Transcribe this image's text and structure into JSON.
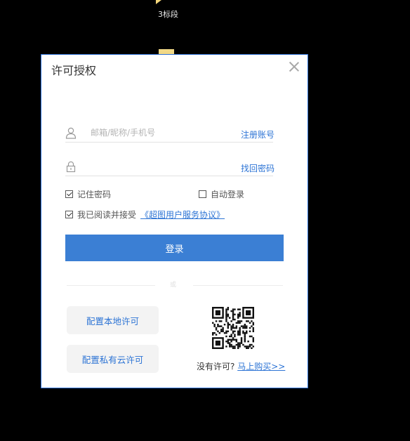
{
  "background": {
    "label": "3标段"
  },
  "dialog": {
    "title": "许可授权",
    "username_placeholder": "邮箱/昵称/手机号",
    "register_link": "注册账号",
    "password_placeholder": "",
    "forgot_link": "找回密码",
    "remember_label": "记住密码",
    "remember_checked": true,
    "autologin_label": "自动登录",
    "autologin_checked": false,
    "agree_label": "我已阅读并接受",
    "agree_checked": true,
    "agreement_link": "《超图用户服务协议》",
    "login_button": "登录",
    "divider_text": "或",
    "config_local_button": "配置本地许可",
    "config_cloud_button": "配置私有云许可",
    "no_license_text": "没有许可?",
    "buy_link": "马上购买>>"
  },
  "colors": {
    "accent": "#3b7fd4",
    "link": "#2d74d5",
    "border": "#2b6fd6"
  },
  "icons": {
    "user": "user-icon",
    "lock": "lock-icon",
    "close": "close-icon",
    "qr": "qr-code-icon"
  }
}
